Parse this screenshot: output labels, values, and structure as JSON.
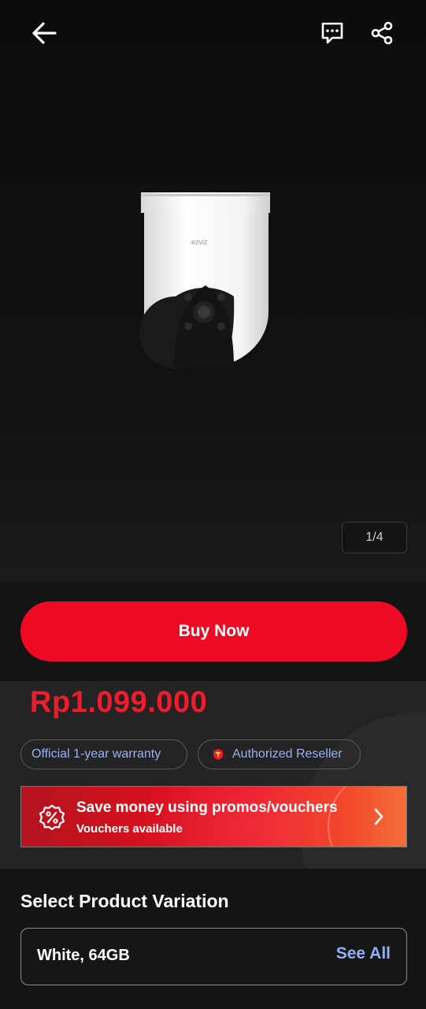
{
  "header": {
    "back_icon": "arrow-left-icon",
    "chat_icon": "chat-bubble-icon",
    "share_icon": "share-icon"
  },
  "gallery": {
    "counter": "1/4",
    "image_subject": "white PTZ security camera"
  },
  "actions": {
    "buy_label": "Buy Now"
  },
  "product": {
    "price": "Rp1.099.000",
    "warranty_chip": "Official 1-year warranty",
    "reseller_chip": "Authorized Reseller"
  },
  "promo": {
    "title": "Save money using promos/vouchers",
    "subtitle": "Vouchers available",
    "icon": "percent-badge-icon"
  },
  "variation": {
    "title": "Select Product Variation",
    "selected": "White, 64GB",
    "see_all": "See All"
  },
  "colors": {
    "accent_red": "#ee0a24",
    "price_red": "#ee1c2d",
    "link_blue": "#8fb0f5",
    "background": "#141414"
  }
}
